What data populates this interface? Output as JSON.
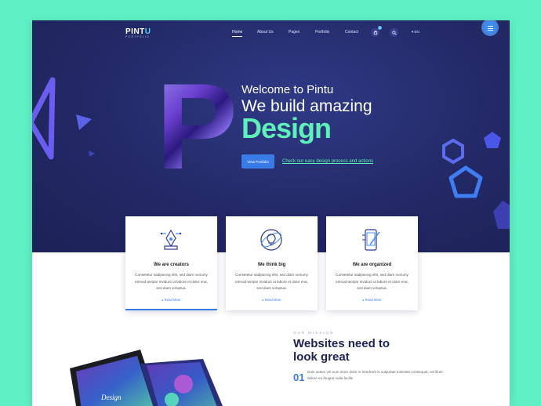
{
  "brand": {
    "name_main": "PINT",
    "name_accent": "U",
    "tagline": "PORTFOLIO"
  },
  "nav": {
    "items": [
      "Home",
      "About Us",
      "Pages",
      "Portfolio",
      "Contact"
    ],
    "cart_count": "0",
    "language": "EN",
    "icons": {
      "cart": "cart-icon",
      "search": "search-icon",
      "menu": "hamburger-icon"
    }
  },
  "hero": {
    "big_letter": "P",
    "welcome": "Welcome to Pintu",
    "headline": "We build amazing",
    "highlight": "Design",
    "cta_button": "View Portfolio",
    "cta_link": "Check our easy design process and actions"
  },
  "features": [
    {
      "icon": "pen-tool-icon",
      "title": "We are creators",
      "body": "Consetetur sadipscing elitr, sed diam nonumy eirmod tempor invidunt ut labore et dolor erat, sed diam voluptua.",
      "link": "Read More"
    },
    {
      "icon": "lightbulb-icon",
      "title": "We think big",
      "body": "Consetetur sadipscing elitr, sed diam nonumy eirmod tempor invidunt ut labore et dolor erat, sed diam voluptua.",
      "link": "Read More"
    },
    {
      "icon": "phone-design-icon",
      "title": "We are organized",
      "body": "Consetetur sadipscing elitr, sed diam nonumy eirmod tempor invidunt ut labore et dolor erat, sed diam voluptua.",
      "link": "Read More"
    }
  ],
  "mission": {
    "label": "OUR MISSION",
    "title_line1": "Websites need to",
    "title_line2": "look great",
    "item_number": "01",
    "item_text": "Duis autem vel eum iriure dolor in hendrerit in vulputate molestie consequat, vel illum dolore eu feugiat nulla facilis"
  },
  "colors": {
    "background": "#5ff0c4",
    "hero": "#232966",
    "accent": "#3a7ce6",
    "highlight": "#5ef0b8"
  }
}
